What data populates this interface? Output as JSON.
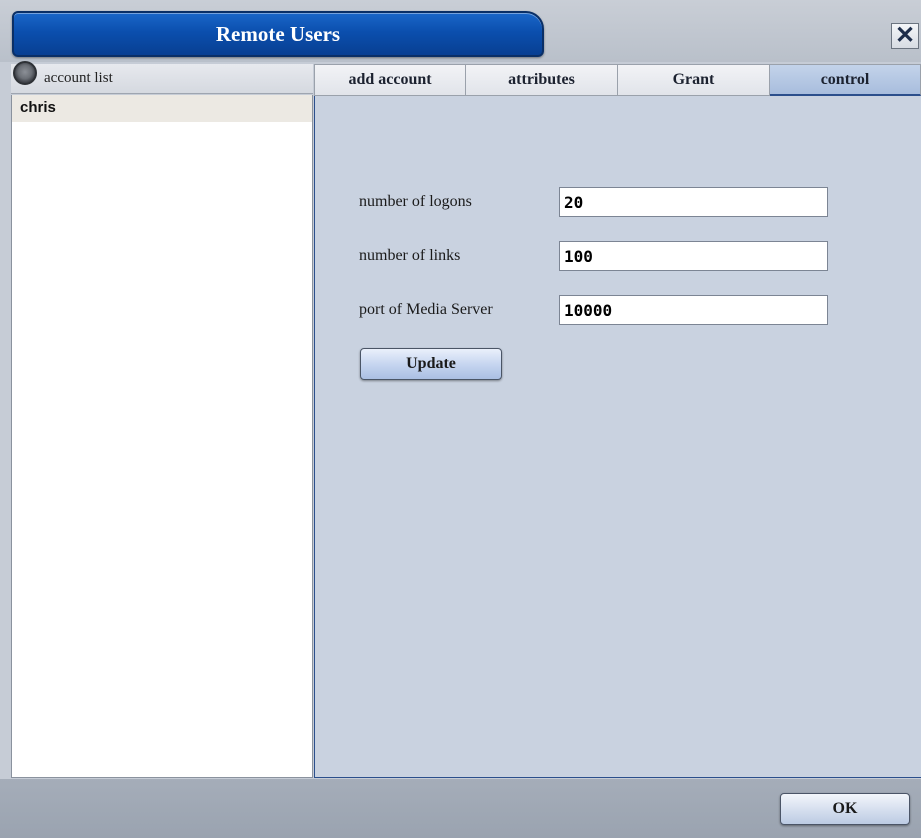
{
  "window": {
    "title": "Remote Users",
    "close_glyph": "✕",
    "close_icon": "close-icon"
  },
  "account_list": {
    "header_label": "account list",
    "header_icon": "radio-icon",
    "items": [
      "chris"
    ]
  },
  "tabs": [
    {
      "label": "add account",
      "active": false
    },
    {
      "label": "attributes",
      "active": false
    },
    {
      "label": "Grant",
      "active": false
    },
    {
      "label": "control",
      "active": true
    }
  ],
  "control": {
    "logons_label": "number of logons",
    "logons_value": "20",
    "links_label": "number of links",
    "links_value": "100",
    "media_port_label": "port of Media Server",
    "media_port_value": "10000",
    "update_label": "Update"
  },
  "footer": {
    "ok_label": "OK"
  },
  "colors": {
    "title_blue": "#0b4fae",
    "content_bg": "#c9d2e0",
    "active_tab": "#a8bddd"
  }
}
